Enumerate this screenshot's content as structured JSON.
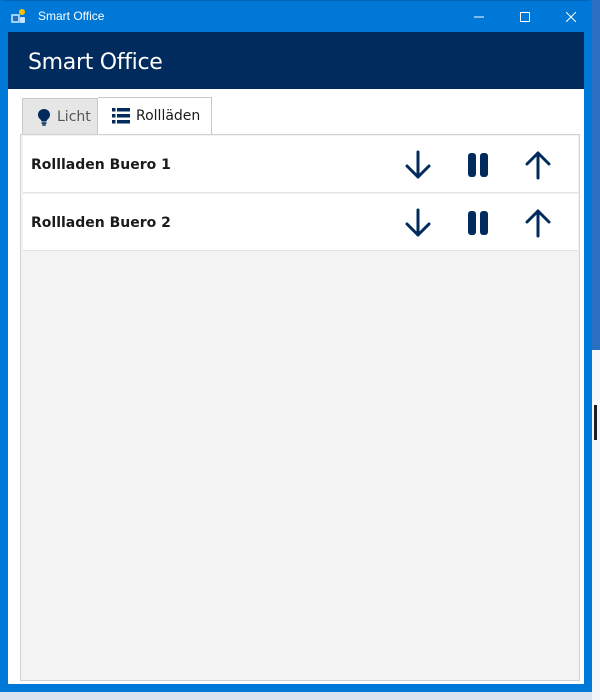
{
  "window": {
    "title": "Smart Office"
  },
  "header": {
    "title": "Smart Office"
  },
  "tabs": [
    {
      "label": "Licht",
      "icon": "lightbulb-icon",
      "selected": false
    },
    {
      "label": "Rollläden",
      "icon": "list-icon",
      "selected": true
    }
  ],
  "blinds": [
    {
      "label": "Rollladen Buero 1",
      "controls": [
        "arrow-down-icon",
        "pause-icon",
        "arrow-up-icon"
      ]
    },
    {
      "label": "Rollladen Buero 2",
      "controls": [
        "arrow-down-icon",
        "pause-icon",
        "arrow-up-icon"
      ]
    }
  ],
  "colors": {
    "titlebar": "#0078d7",
    "header": "#002b5c",
    "icon": "#002b5c"
  }
}
